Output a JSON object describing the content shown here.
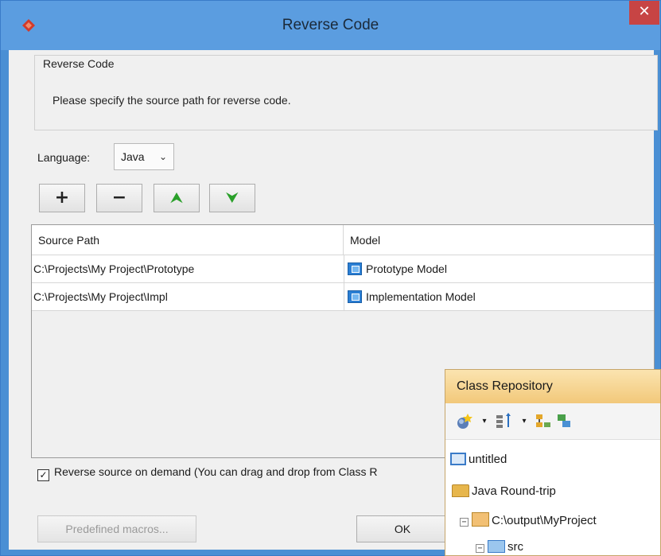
{
  "window": {
    "title": "Reverse Code",
    "close_glyph": "✕"
  },
  "group": {
    "title": "Reverse Code",
    "description": "Please specify the source path for reverse code."
  },
  "language": {
    "label": "Language:",
    "value": "Java",
    "chevron": "⌄"
  },
  "toolbar": {
    "add_glyph": "+",
    "remove_glyph": "−",
    "up_glyph": "⮝",
    "down_glyph": "⮟"
  },
  "table": {
    "headers": [
      "Source Path",
      "Model"
    ],
    "rows": [
      {
        "path": "C:\\Projects\\My Project\\Prototype",
        "model": "Prototype Model"
      },
      {
        "path": "C:\\Projects\\My Project\\Impl",
        "model": "Implementation Model"
      }
    ]
  },
  "options": {
    "reverse_on_demand_checked": true,
    "checkmark": "✓",
    "reverse_on_demand_label": "Reverse source on demand (You can drag and drop from Class R"
  },
  "buttons": {
    "predefined_macros": "Predefined macros...",
    "ok": "OK"
  },
  "repository": {
    "title": "Class Repository",
    "tree": [
      {
        "label": "untitled",
        "icon": "project-icon"
      },
      {
        "label": "Java Round-trip",
        "icon": "folder-open-icon"
      },
      {
        "label": "C:\\output\\MyProject",
        "icon": "jar-folder-icon",
        "expander": "−"
      },
      {
        "label": "src",
        "icon": "package-folder-icon",
        "expander": "−"
      }
    ]
  },
  "colors": {
    "titlebar": "#5b9de0",
    "window_border": "#4a8fd4",
    "close": "#c74444",
    "repo_header": "#f2c87a",
    "arrow_green": "#2aa02a"
  }
}
